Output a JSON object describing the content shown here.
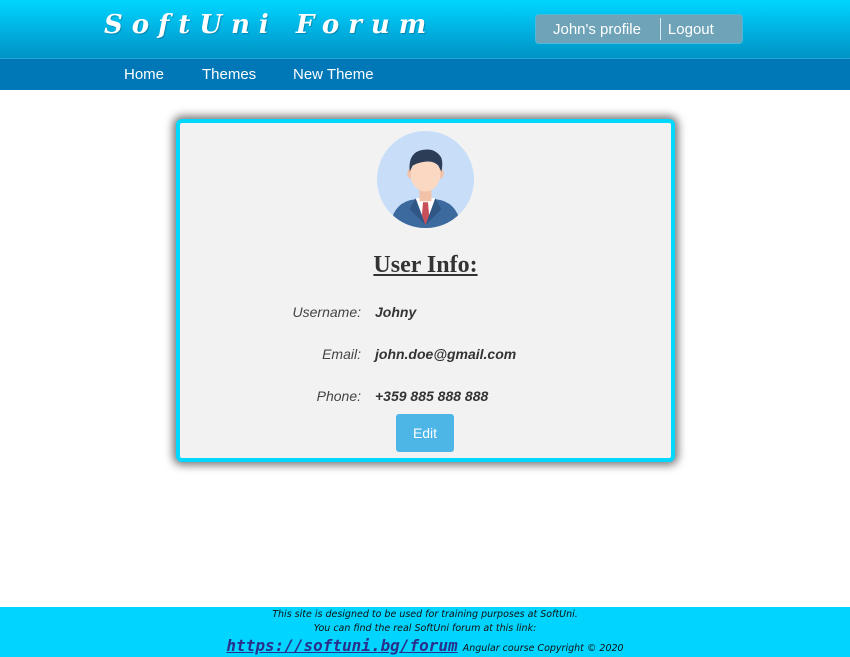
{
  "header": {
    "logo_text": "SoftUni Forum",
    "profile_link": "John's profile",
    "logout_link": "Logout"
  },
  "nav": {
    "items": [
      {
        "label": "Home"
      },
      {
        "label": "Themes"
      },
      {
        "label": "New Theme"
      }
    ]
  },
  "profile": {
    "avatar_icon": "user-avatar-icon",
    "title": "User Info:",
    "fields": [
      {
        "label": "Username:",
        "value": "Johny"
      },
      {
        "label": "Email:",
        "value": "john.doe@gmail.com"
      },
      {
        "label": "Phone:",
        "value": "+359 885 888 888"
      }
    ],
    "edit_label": "Edit"
  },
  "footer": {
    "line1": "This site is designed to be used for training purposes at SoftUni.",
    "line2": "You can find the real SoftUni forum at this link:",
    "link_text": "https://softuni.bg/forum",
    "copyright": "Angular course Copyright © 2020"
  },
  "colors": {
    "header_gradient_top": "#00d6ff",
    "nav_bar": "#0077b6",
    "card_border": "#00d8ff",
    "edit_button": "#4db6e6",
    "footer_bg": "#00d4ff"
  }
}
